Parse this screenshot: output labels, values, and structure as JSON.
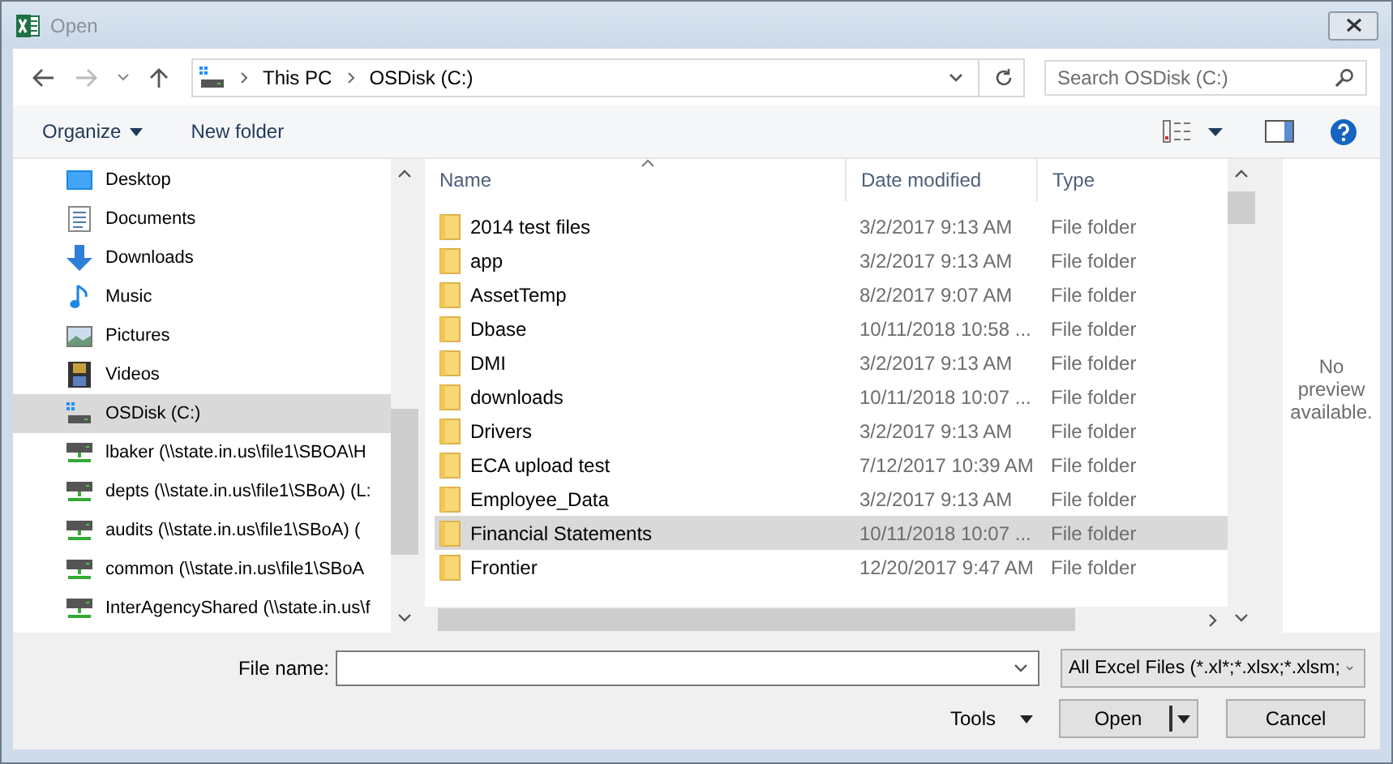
{
  "window": {
    "title": "Open"
  },
  "nav": {
    "path": [
      "This PC",
      "OSDisk (C:)"
    ],
    "search_placeholder": "Search OSDisk (C:)"
  },
  "toolbar": {
    "organize": "Organize",
    "new_folder": "New folder"
  },
  "sidebar": {
    "items": [
      {
        "label": "Desktop",
        "kind": "desktop",
        "selected": false
      },
      {
        "label": "Documents",
        "kind": "documents",
        "selected": false
      },
      {
        "label": "Downloads",
        "kind": "downloads",
        "selected": false
      },
      {
        "label": "Music",
        "kind": "music",
        "selected": false
      },
      {
        "label": "Pictures",
        "kind": "pictures",
        "selected": false
      },
      {
        "label": "Videos",
        "kind": "videos",
        "selected": false
      },
      {
        "label": "OSDisk (C:)",
        "kind": "drive",
        "selected": true
      },
      {
        "label": "lbaker (\\\\state.in.us\\file1\\SBOA\\H",
        "kind": "network",
        "selected": false
      },
      {
        "label": "depts (\\\\state.in.us\\file1\\SBoA) (L:",
        "kind": "network",
        "selected": false
      },
      {
        "label": "audits (\\\\state.in.us\\file1\\SBoA) (",
        "kind": "network",
        "selected": false
      },
      {
        "label": "common (\\\\state.in.us\\file1\\SBoA",
        "kind": "network",
        "selected": false
      },
      {
        "label": "InterAgencyShared (\\\\state.in.us\\f",
        "kind": "network",
        "selected": false
      }
    ]
  },
  "files": {
    "columns": [
      "Name",
      "Date modified",
      "Type"
    ],
    "rows": [
      {
        "name": "2014 test files",
        "date": "3/2/2017 9:13 AM",
        "type": "File folder",
        "selected": false
      },
      {
        "name": "app",
        "date": "3/2/2017 9:13 AM",
        "type": "File folder",
        "selected": false
      },
      {
        "name": "AssetTemp",
        "date": "8/2/2017 9:07 AM",
        "type": "File folder",
        "selected": false
      },
      {
        "name": "Dbase",
        "date": "10/11/2018 10:58 ...",
        "type": "File folder",
        "selected": false
      },
      {
        "name": "DMI",
        "date": "3/2/2017 9:13 AM",
        "type": "File folder",
        "selected": false
      },
      {
        "name": "downloads",
        "date": "10/11/2018 10:07 ...",
        "type": "File folder",
        "selected": false
      },
      {
        "name": "Drivers",
        "date": "3/2/2017 9:13 AM",
        "type": "File folder",
        "selected": false
      },
      {
        "name": "ECA upload test",
        "date": "7/12/2017 10:39 AM",
        "type": "File folder",
        "selected": false
      },
      {
        "name": "Employee_Data",
        "date": "3/2/2017 9:13 AM",
        "type": "File folder",
        "selected": false
      },
      {
        "name": "Financial Statements",
        "date": "10/11/2018 10:07 ...",
        "type": "File folder",
        "selected": true
      },
      {
        "name": "Frontier",
        "date": "12/20/2017 9:47 AM",
        "type": "File folder",
        "selected": false
      }
    ]
  },
  "preview": {
    "message": "No preview available."
  },
  "footer": {
    "file_name_label": "File name:",
    "filter": "All Excel Files (*.xl*;*.xlsx;*.xlsm;",
    "tools": "Tools",
    "open": "Open",
    "cancel": "Cancel"
  }
}
